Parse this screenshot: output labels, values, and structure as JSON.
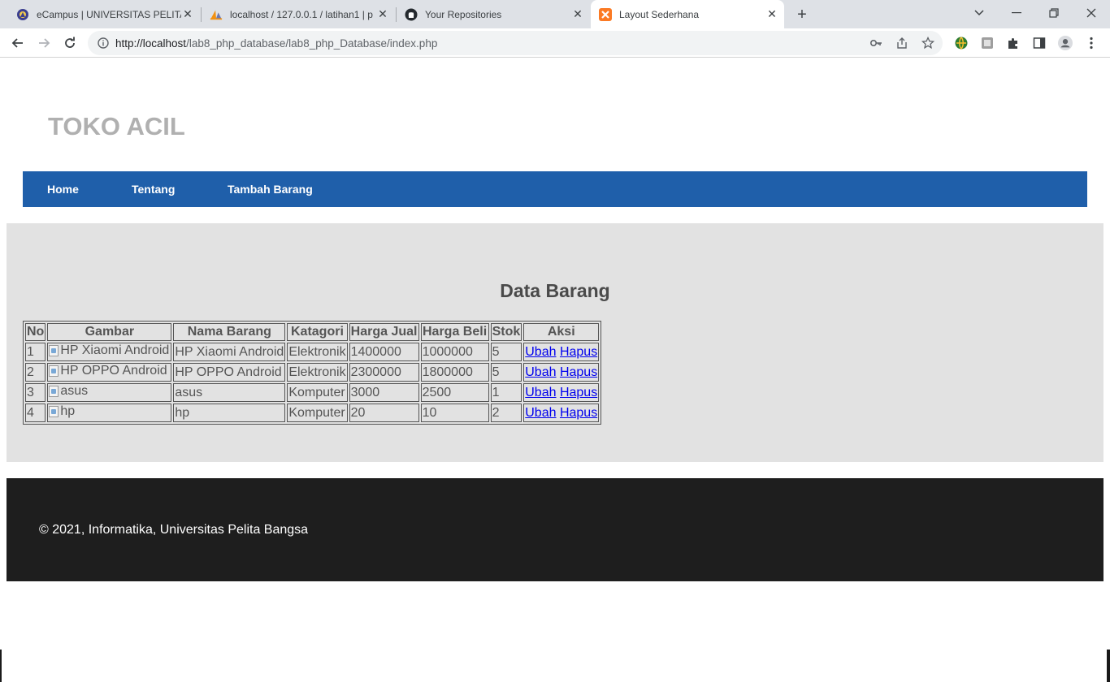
{
  "browser": {
    "tabs": [
      {
        "title": "eCampus | UNIVERSITAS PELITA B",
        "icon": "campus-crest-icon"
      },
      {
        "title": "localhost / 127.0.0.1 / latihan1 | p",
        "icon": "phpmyadmin-sail-icon"
      },
      {
        "title": "Your Repositories",
        "icon": "github-icon"
      },
      {
        "title": "Layout Sederhana",
        "icon": "xampp-icon"
      }
    ],
    "url_host": "http://localhost",
    "url_path": "/lab8_php_database/lab8_php_Database/index.php",
    "accent": "#1f5faa"
  },
  "site": {
    "title": "TOKO ACIL",
    "nav": {
      "home": "Home",
      "tentang": "Tentang",
      "tambah": "Tambah Barang"
    },
    "heading": "Data Barang",
    "table": {
      "headers": [
        "No",
        "Gambar",
        "Nama Barang",
        "Katagori",
        "Harga Jual",
        "Harga Beli",
        "Stok",
        "Aksi"
      ],
      "rows": [
        {
          "no": "1",
          "gambar": "HP Xiaomi Android",
          "nama": "HP Xiaomi Android",
          "kategori": "Elektronik",
          "jual": "1400000",
          "beli": "1000000",
          "stok": "5",
          "ubah": "Ubah",
          "hapus": "Hapus"
        },
        {
          "no": "2",
          "gambar": "HP OPPO Android",
          "nama": "HP OPPO Android",
          "kategori": "Elektronik",
          "jual": "2300000",
          "beli": "1800000",
          "stok": "5",
          "ubah": "Ubah",
          "hapus": "Hapus"
        },
        {
          "no": "3",
          "gambar": "asus",
          "nama": "asus",
          "kategori": "Komputer",
          "jual": "3000",
          "beli": "2500",
          "stok": "1",
          "ubah": "Ubah",
          "hapus": "Hapus"
        },
        {
          "no": "4",
          "gambar": "hp",
          "nama": "hp",
          "kategori": "Komputer",
          "jual": "20",
          "beli": "10",
          "stok": "2",
          "ubah": "Ubah",
          "hapus": "Hapus"
        }
      ]
    },
    "footer": "© 2021, Informatika, Universitas Pelita Bangsa"
  }
}
